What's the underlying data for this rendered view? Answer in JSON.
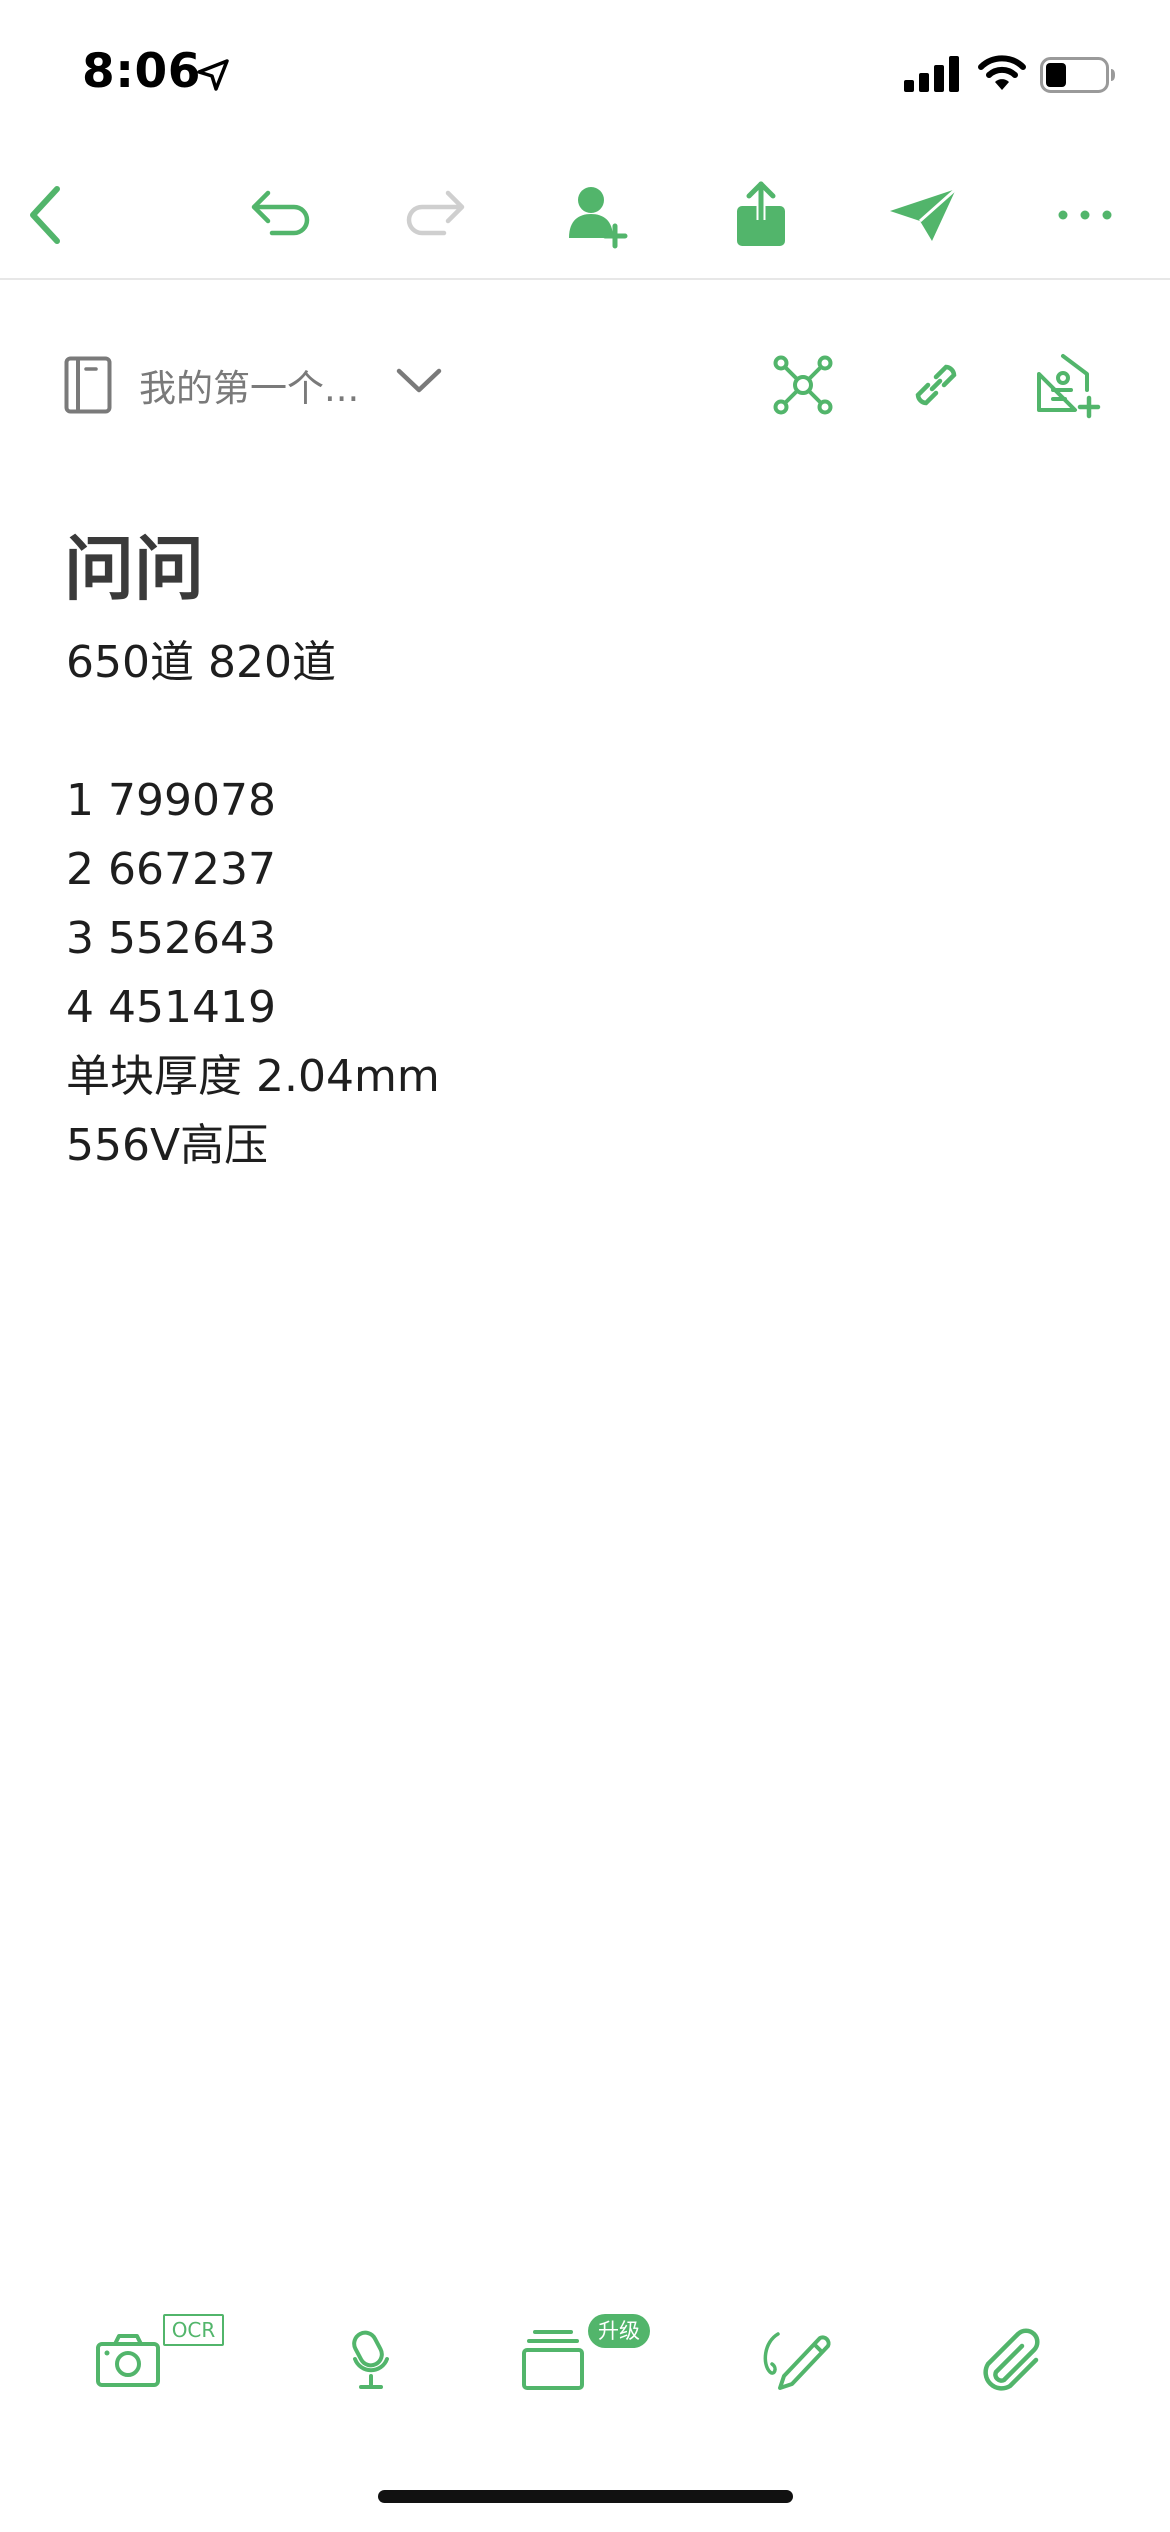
{
  "theme": {
    "accent": "#52b56b",
    "disabled": "#cfcfcf",
    "muted": "#7a7a7a"
  },
  "status_bar": {
    "time": "8:06",
    "icons": [
      "location-arrow-icon",
      "cellular-signal-icon",
      "wifi-icon",
      "battery-icon"
    ],
    "battery_level": 0.3
  },
  "toolbar": {
    "buttons": [
      "back-icon",
      "undo-icon",
      "redo-icon",
      "add-person-icon",
      "share-icon",
      "send-icon",
      "more-icon"
    ]
  },
  "notebook": {
    "name": "我的第一个..."
  },
  "note_actions": [
    "mind-map-icon",
    "link-icon",
    "add-tag-icon"
  ],
  "note": {
    "title": "问问",
    "lines": [
      "650道 820道",
      "",
      "1 799078",
      "2 667237",
      "3 552643",
      "4 451419",
      "单块厚度 2.04mm",
      "556V高压"
    ]
  },
  "bottom_bar": {
    "buttons": [
      "camera-icon",
      "microphone-icon",
      "cards-icon",
      "pen-icon",
      "paperclip-icon"
    ],
    "ocr_badge": "OCR",
    "upgrade_badge": "升级"
  }
}
